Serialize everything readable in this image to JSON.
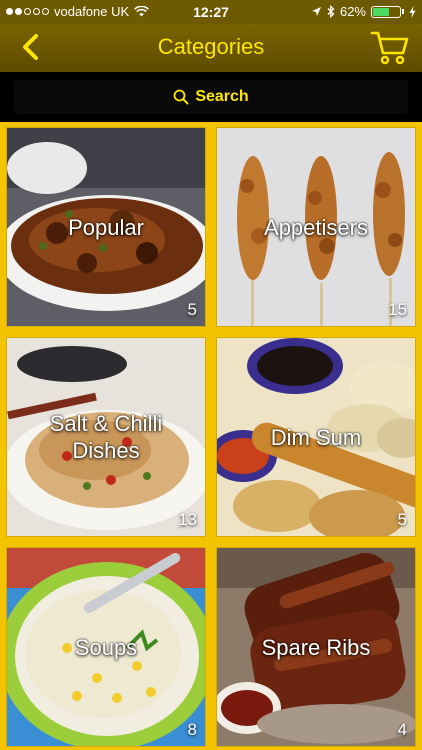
{
  "status_bar": {
    "carrier": "vodafone UK",
    "time": "12:27",
    "battery_percent": "62%",
    "battery_level": 0.62,
    "signal_bars_filled": 2,
    "signal_bars_total": 5
  },
  "nav": {
    "title": "Categories",
    "back_icon": "chevron-left-icon",
    "cart_icon": "shopping-cart-icon"
  },
  "search": {
    "label": "Search",
    "icon": "search-icon"
  },
  "colors": {
    "accent": "#ffe600",
    "background": "#f5c400",
    "nav": "#6e5a00"
  },
  "categories": [
    {
      "label": "Popular",
      "count": "5"
    },
    {
      "label": "Appetisers",
      "count": "15"
    },
    {
      "label": "Salt & Chilli Dishes",
      "count": "13"
    },
    {
      "label": "Dim Sum",
      "count": "5"
    },
    {
      "label": "Soups",
      "count": "8"
    },
    {
      "label": "Spare Ribs",
      "count": "4"
    }
  ]
}
